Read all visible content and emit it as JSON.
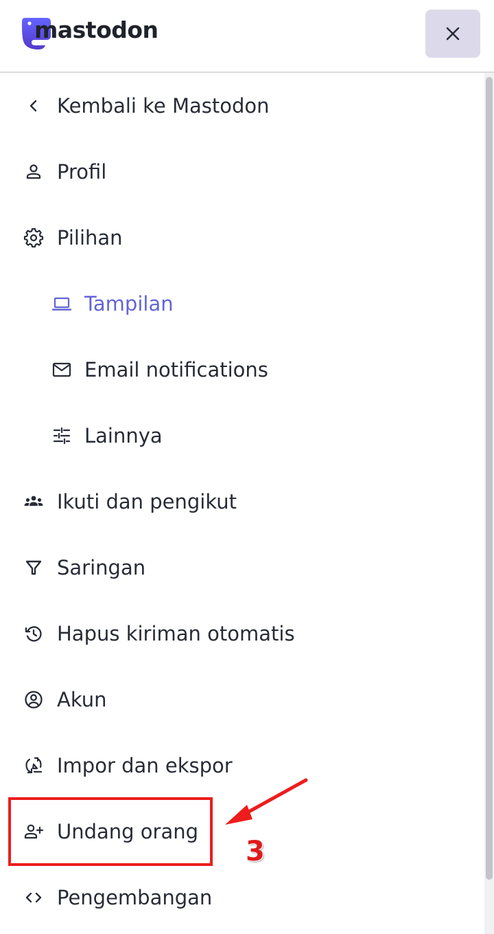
{
  "header": {
    "logo_text": "mastodon",
    "close_icon": "close-icon"
  },
  "menu": {
    "items": [
      {
        "label": "Kembali ke Mastodon",
        "icon": "chevron-left-icon",
        "level": 0,
        "active": false
      },
      {
        "label": "Profil",
        "icon": "person-icon",
        "level": 0,
        "active": false
      },
      {
        "label": "Pilihan",
        "icon": "gear-icon",
        "level": 0,
        "active": false
      },
      {
        "label": "Tampilan",
        "icon": "laptop-icon",
        "level": 1,
        "active": true
      },
      {
        "label": "Email notifications",
        "icon": "mail-icon",
        "level": 1,
        "active": false
      },
      {
        "label": "Lainnya",
        "icon": "sliders-icon",
        "level": 1,
        "active": false
      },
      {
        "label": "Ikuti dan pengikut",
        "icon": "group-icon",
        "level": 0,
        "active": false
      },
      {
        "label": "Saringan",
        "icon": "filter-icon",
        "level": 0,
        "active": false
      },
      {
        "label": "Hapus kiriman otomatis",
        "icon": "history-icon",
        "level": 0,
        "active": false
      },
      {
        "label": "Akun",
        "icon": "account-circle-icon",
        "level": 0,
        "active": false
      },
      {
        "label": "Impor dan ekspor",
        "icon": "import-export-icon",
        "level": 0,
        "active": false
      },
      {
        "label": "Undang orang",
        "icon": "person-add-icon",
        "level": 0,
        "active": false
      },
      {
        "label": "Pengembangan",
        "icon": "code-icon",
        "level": 0,
        "active": false
      }
    ]
  },
  "annotation": {
    "step_number": "3",
    "color": "#ee1c1c"
  },
  "colors": {
    "accent": "#6364d6",
    "text": "#282c37",
    "close_bg": "#dcdaea",
    "logo_purple": "#6364ff"
  }
}
